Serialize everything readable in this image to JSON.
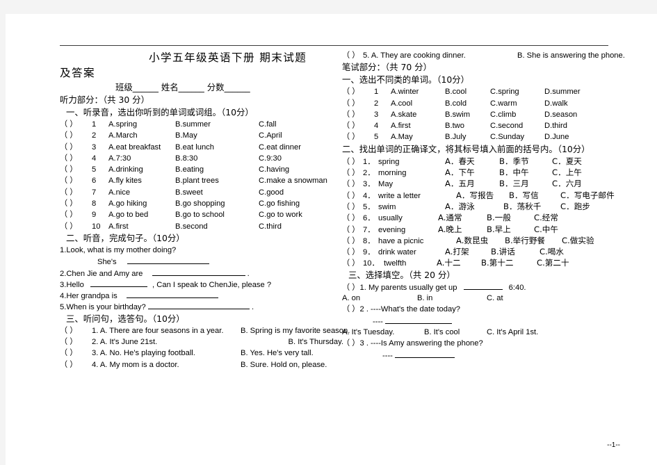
{
  "document": {
    "title_line1": "小学五年级英语下册 期末试题",
    "title_line2": "及答案",
    "id_line": "班级______  姓名______  分数______",
    "footer": "--1--"
  },
  "listening": {
    "heading": "听力部分：（共 30 分）",
    "section1": {
      "heading": "一、听录音，选出你听到的单词或词组。（10分）",
      "items": [
        {
          "paren": "（    ）",
          "n": "1",
          "a": "A.spring",
          "b": "B.summer",
          "c": "C.fall"
        },
        {
          "paren": "（    ）",
          "n": "2",
          "a": "A.March",
          "b": "B.May",
          "c": "C.April"
        },
        {
          "paren": "（    ）",
          "n": "3",
          "a": "A.eat breakfast",
          "b": "B.eat lunch",
          "c": "C.eat dinner"
        },
        {
          "paren": "（    ）",
          "n": "4",
          "a": "A.7:30",
          "b": "B.8:30",
          "c": "C.9:30"
        },
        {
          "paren": "（    ）",
          "n": "5",
          "a": "A.drinking",
          "b": "B.eating",
          "c": "C.having"
        },
        {
          "paren": "（    ）",
          "n": "6",
          "a": "A.fly kites",
          "b": "B.plant trees",
          "c": "C.make a snowman"
        },
        {
          "paren": "（    ）",
          "n": "7",
          "a": "A.nice",
          "b": "B.sweet",
          "c": "C.good"
        },
        {
          "paren": "（    ）",
          "n": "8",
          "a": "A.go hiking",
          "b": "B.go shopping",
          "c": "C.go fishing"
        },
        {
          "paren": "（    ）",
          "n": "9",
          "a": "A.go to bed",
          "b": "B.go to school",
          "c": "C.go to work"
        },
        {
          "paren": "（    ）",
          "n": "10",
          "a": "A.first",
          "b": "B.second",
          "c": "C.third"
        }
      ]
    },
    "section2": {
      "heading": "二、听音，完成句子。（10分）",
      "q1_line1": "1.Look, what is my mother doing?",
      "q1_line2": "She's",
      "q2": "2.Chen Jie and Amy are",
      "q2_tail": ".",
      "q3_a": "3.Hello",
      "q3_b": ", Can I speak to ChenJie, please ?",
      "q4": "4.Her grandpa is",
      "q5": "5.When is your birthday?",
      "q5_tail": "."
    },
    "section3": {
      "heading": "三、听问句，选答句。（10分）",
      "items": [
        {
          "paren": "（    ）",
          "a": "1. A. There are four seasons in a year.",
          "b": "B. Spring is my favorite season."
        },
        {
          "paren": "（    ）",
          "a": "2. A. It's June 21st.",
          "b": "B. It's Thursday."
        },
        {
          "paren": "（    ）",
          "a": "3. A. No. He's playing football.",
          "b": "B. Yes. He's very tall."
        },
        {
          "paren": "（    ）",
          "a": "4. A. My mom is a doctor.",
          "b": "B. Sure. Hold on, please."
        },
        {
          "paren": "（  ）",
          "a": "5. A. They are cooking dinner.",
          "b": "B. She is answering the phone."
        }
      ]
    }
  },
  "written": {
    "heading": "笔试部分：（共 70 分）",
    "section1": {
      "heading": "一、选出不同类的单词。（10分）",
      "items": [
        {
          "paren": "（     ）",
          "n": "1",
          "a": "A.winter",
          "b": "B.cool",
          "c": "C.spring",
          "d": "D.summer"
        },
        {
          "paren": "（     ）",
          "n": "2",
          "a": "A.cool",
          "b": "B.cold",
          "c": "C.warm",
          "d": "D.walk"
        },
        {
          "paren": "（     ）",
          "n": "3",
          "a": "A.skate",
          "b": "B.swim",
          "c": "C.climb",
          "d": "D.season"
        },
        {
          "paren": "（     ）",
          "n": "4",
          "a": "A.first",
          "b": "B.two",
          "c": "C.second",
          "d": "D.third"
        },
        {
          "paren": "（     ）",
          "n": "5",
          "a": "A.May",
          "b": "B.July",
          "c": "C.Sunday",
          "d": "D.June"
        }
      ]
    },
    "section2": {
      "heading": "二、找出单词的正确译文，将其标号填入前面的括号内。（10分）",
      "items": [
        {
          "paren": "（  ）",
          "n": "1．",
          "word": "spring",
          "a": "A．春天",
          "b": "B．季节",
          "c": "C．夏天"
        },
        {
          "paren": "（  ）",
          "n": "2．",
          "word": "morning",
          "a": "A．下午",
          "b": "B．中午",
          "c": "C．上午"
        },
        {
          "paren": "（  ）",
          "n": "3．",
          "word": "May",
          "a": "A．五月",
          "b": "B．三月",
          "c": "C．六月"
        },
        {
          "paren": "（  ）",
          "n": "4．",
          "word": "write a letter",
          "a": "A．写报告",
          "b": "B．写信",
          "c": "C．写电子邮件"
        },
        {
          "paren": "（  ）",
          "n": "5．",
          "word": "swim",
          "a": "A．游泳",
          "b": "B．荡秋千",
          "c": "C．跑步"
        },
        {
          "paren": "（  ）",
          "n": "6．",
          "word": "usually",
          "a": "A.通常",
          "b": "B.一般",
          "c": "C.经常"
        },
        {
          "paren": "（  ）",
          "n": "7．",
          "word": "evening",
          "a": "A.晚上",
          "b": "B.早上",
          "c": "C.中午"
        },
        {
          "paren": "（  ）",
          "n": "8．",
          "word": "have a picnic",
          "a": "A.数昆虫",
          "b": "B.举行野餐",
          "c": "C.做实验"
        },
        {
          "paren": "（  ）",
          "n": "9．",
          "word": "drink water",
          "a": "A.打架",
          "b": "B.讲话",
          "c": "C.喝水"
        },
        {
          "paren": "（  ）",
          "n": "10．",
          "word": "twelfth",
          "a": "A.十二",
          "b": "B.第十二",
          "c": "C.第二十"
        }
      ]
    },
    "section3": {
      "heading": "三、选择填空。（共 20 分）",
      "q1": {
        "stem_paren": "（  ）1.",
        "stem_a": "My parents usually get up",
        "stem_b": "6:40.",
        "a": "A. on",
        "b": "B. in",
        "c": "C. at"
      },
      "q2": {
        "stem_paren": "（  ）2 .",
        "stem": "----What's the date today?",
        "answer_dash": "----",
        "a": "A. It's Tuesday.",
        "b": "B. It's cool",
        "c": "C. It's April 1st."
      },
      "q3": {
        "stem_paren": "（  ）3 .",
        "stem": "----Is Amy answering the phone?",
        "answer_dash": "----"
      }
    }
  }
}
